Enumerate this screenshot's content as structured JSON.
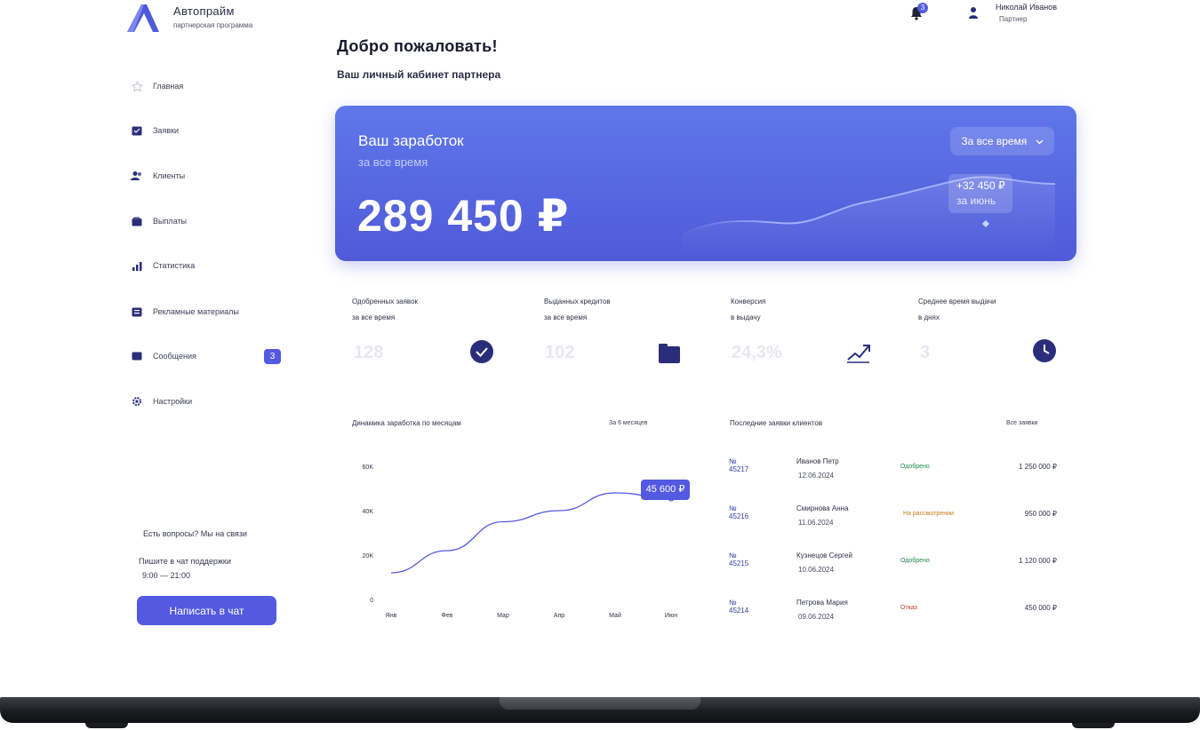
{
  "brand": {
    "name": "Автопрайм",
    "tagline": "партнерская программа"
  },
  "header": {
    "title": "Добро пожаловать!",
    "subtitle": "Ваш личный кабинет партнера",
    "notifications_count": "3",
    "user_name": "Николай Иванов",
    "user_role": "Партнер"
  },
  "sidebar": {
    "items": [
      {
        "label": "Главная",
        "icon": "star-icon"
      },
      {
        "label": "Заявки",
        "icon": "document-icon"
      },
      {
        "label": "Клиенты",
        "icon": "users-icon"
      },
      {
        "label": "Выплаты",
        "icon": "wallet-icon"
      },
      {
        "label": "Статистика",
        "icon": "bar-chart-icon"
      },
      {
        "label": "Рекламные материалы",
        "icon": "file-icon"
      },
      {
        "label": "Сообщения",
        "icon": "mail-icon",
        "badge": "3"
      },
      {
        "label": "Настройки",
        "icon": "gear-icon"
      }
    ],
    "support": {
      "question": "Есть вопросы? Мы на связи",
      "text": "Пишите в чат поддержки",
      "hours": "9:00 — 21:00",
      "button_label": "Написать в чат"
    }
  },
  "earnings": {
    "title": "Ваш заработок",
    "subtitle": "за все время",
    "value": "289 450 ₽",
    "period_label": "За все время",
    "tooltip_value": "+32 450 ₽",
    "tooltip_label": "за июнь"
  },
  "stats": [
    {
      "label_line1": "Одобренных заявок",
      "label_line2": "за все время",
      "value": "128",
      "icon": "check-circle-icon"
    },
    {
      "label_line1": "Выданных кредитов",
      "label_line2": "за все время",
      "value": "102",
      "icon": "folder-icon"
    },
    {
      "label_line1": "Конверсия",
      "label_line2": "в выдачу",
      "value": "24,3%",
      "icon": "trend-up-icon"
    },
    {
      "label_line1": "Среднее время выдачи",
      "label_line2": "в днях",
      "value": "3",
      "icon": "clock-icon"
    }
  ],
  "line_chart": {
    "title": "Динамика заработка по месяцам",
    "period": "За 6 месяцев",
    "tooltip": "45 600 ₽"
  },
  "chart_data": {
    "type": "line",
    "title": "Динамика заработка по месяцам",
    "categories": [
      "Янв",
      "Фев",
      "Мар",
      "Апр",
      "Май",
      "Июн"
    ],
    "series": [
      {
        "values": [
          12000,
          22000,
          35000,
          40000,
          48000,
          45600
        ]
      }
    ],
    "yticks": [
      "60K",
      "40K",
      "20K",
      "0"
    ],
    "ylim": [
      0,
      60000
    ],
    "grid": false,
    "highlight": {
      "x": "Июн",
      "label": "45 600 ₽"
    },
    "color": "#5359e0"
  },
  "applications": {
    "title": "Последние заявки клиентов",
    "link": "Все заявки",
    "rows": [
      {
        "id": "№ 45217",
        "client": "Иванов Петр",
        "date": "12.06.2024",
        "status": "Одобрено",
        "status_color": "#1f8a4c",
        "amount": "1 250 000 ₽"
      },
      {
        "id": "№ 45216",
        "client": "Смирнова Анна",
        "date": "11.06.2024",
        "status": "На рассмотрении",
        "status_color": "#c47a12",
        "amount": "950 000 ₽"
      },
      {
        "id": "№ 45215",
        "client": "Кузнецов Сергей",
        "date": "10.06.2024",
        "status": "Одобрено",
        "status_color": "#1f8a4c",
        "amount": "1 120 000 ₽"
      },
      {
        "id": "№ 45214",
        "client": "Петрова Мария",
        "date": "09.06.2024",
        "status": "Отказ",
        "status_color": "#c0392b",
        "amount": "450 000 ₽"
      }
    ]
  },
  "colors": {
    "accent": "#5359e0",
    "card_gradient_top": "#5f77ea",
    "card_gradient_bottom": "#4f5ad8"
  }
}
